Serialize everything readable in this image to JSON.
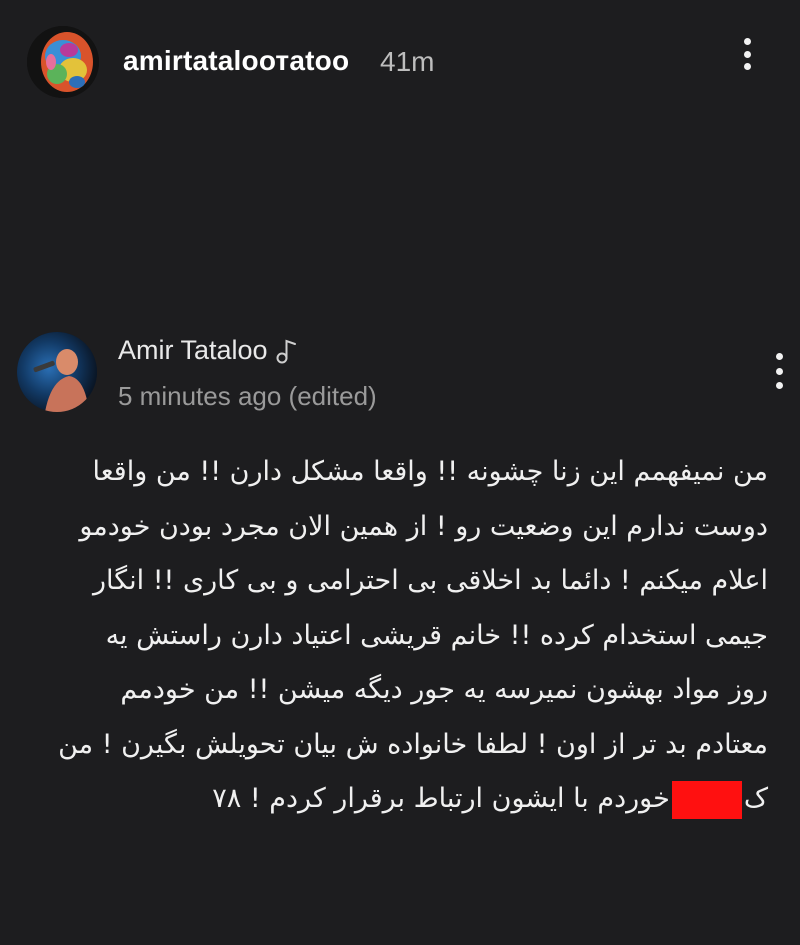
{
  "story": {
    "username": "amirtataloотatoo",
    "time_ago": "41m"
  },
  "comment": {
    "author": "Amir Tataloo",
    "meta": "5 minutes ago (edited)",
    "lines": [
      "من نمیفهمم این زنا چشونه !! واقعا مشکل دارن !! من واقعا",
      "دوست ندارم این وضعیت رو ! از همین الان مجرد بودن خودمو",
      "اعلام میکنم ! دائما بد اخلاقی بی احترامی و بی کاری !! انگار",
      "جیمی استخدام کرده !! خانم قریشی اعتیاد دارن راستش یه",
      "روز مواد بهشون نمیرسه یه جور دیگه میشن !! من خودمم",
      "معتادم بد تر از اون ! لطفا خانواده ش بیان تحویلش بگیرن ! من"
    ],
    "last_line_before": "ک",
    "last_line_after": "خوردم با ایشون ارتباط برقرار کردم ! ۷۸"
  },
  "icons": {
    "story_menu": "vertical-dots-icon",
    "comment_menu": "vertical-dots-icon",
    "music": "music-note-icon"
  },
  "colors": {
    "background": "#1d1d1f",
    "redaction": "#ff1010"
  }
}
